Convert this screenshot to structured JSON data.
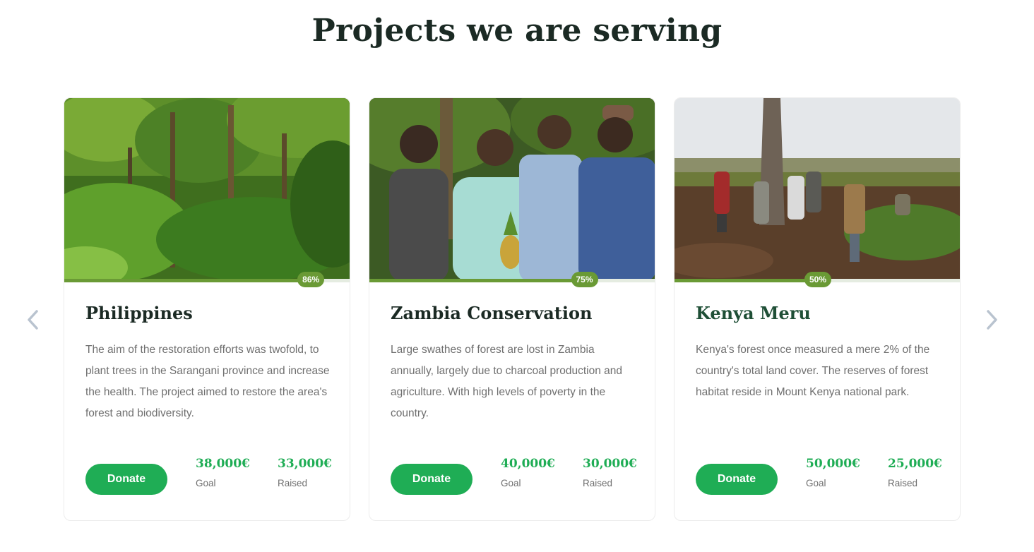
{
  "section": {
    "title": "Projects we are serving"
  },
  "nav": {
    "prev_icon": "chevron-left-icon",
    "next_icon": "chevron-right-icon"
  },
  "colors": {
    "accent_green": "#1fad55",
    "progress_green": "#6a9a35",
    "title_dark": "#1b2a24"
  },
  "projects": [
    {
      "title": "Philippines",
      "description": "The aim of the restoration efforts was twofold, to plant trees in the Sarangani province and increase the health. The project aimed to restore the area's forest and biodiversity.",
      "progress": "86%",
      "donate_label": "Donate",
      "goal": "38,000€",
      "goal_label": "Goal",
      "raised": "33,000€",
      "raised_label": "Raised"
    },
    {
      "title": "Zambia Conservation",
      "description": "Large swathes of forest are lost in Zambia annually, largely due to charcoal production and agriculture. With high levels of poverty in the country.",
      "progress": "75%",
      "donate_label": "Donate",
      "goal": "40,000€",
      "goal_label": "Goal",
      "raised": "30,000€",
      "raised_label": "Raised"
    },
    {
      "title": "Kenya Meru",
      "description": "Kenya's forest once measured a mere 2% of the country's total land cover. The reserves of forest habitat reside in Mount Kenya national park.",
      "progress": "50%",
      "donate_label": "Donate",
      "goal": "50,000€",
      "goal_label": "Goal",
      "raised": "25,000€",
      "raised_label": "Raised"
    }
  ]
}
